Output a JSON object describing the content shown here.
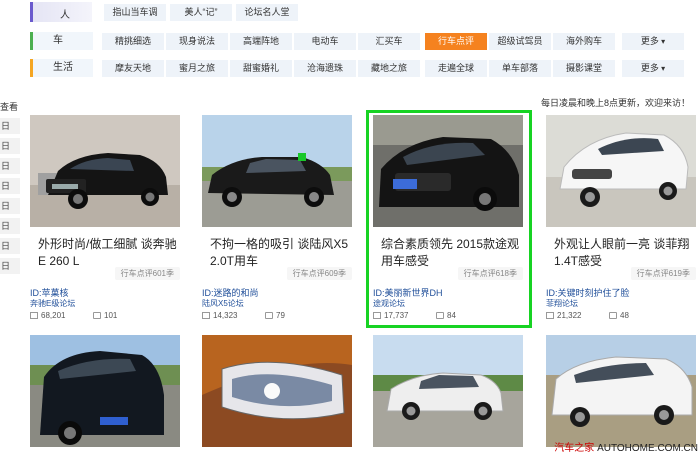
{
  "topbar": {
    "item1": "人",
    "items": [
      "指山当车调",
      "美人“记”",
      "论坛名人堂"
    ]
  },
  "nav_rows": [
    {
      "category": "车",
      "accent": "#4caf50",
      "items": [
        "精挑细选",
        "现身说法",
        "高端阵地",
        "电动车",
        "汇买车",
        "行车点评",
        "超级试驾员",
        "海外购车",
        "更多"
      ]
    },
    {
      "category": "生活",
      "accent": "#f5a623",
      "items": [
        "摩友天地",
        "蜜月之旅",
        "甜蜜婚礼",
        "沧海遗珠",
        "藏地之旅",
        "走遍全球",
        "单车部落",
        "摄影课堂",
        "更多"
      ]
    }
  ],
  "active_nav": "行车点评",
  "left_strip": {
    "label": "查看",
    "cells": [
      "日",
      "日",
      "日",
      "日",
      "日",
      "日",
      "日",
      "日"
    ]
  },
  "notice": "每日凌晨和晚上8点更新，欢迎来访！",
  "cards": [
    {
      "title": "外形时尚/做工细腻 谈奔驰E 260 L",
      "tag": "行车点评601季",
      "author": "ID:苹菓核",
      "forum": "奔驰E级论坛",
      "views": "68,201",
      "replies": "101"
    },
    {
      "title": "不拘一格的吸引 谈陆风X5 2.0T用车",
      "tag": "行车点评609季",
      "author": "ID:迷路的和尚",
      "forum": "陆风X5论坛",
      "views": "14,323",
      "replies": "79"
    },
    {
      "title": "综合素质领先 2015款途观用车感受",
      "tag": "行车点评618季",
      "author": "ID:美丽新世界DH",
      "forum": "途观论坛",
      "views": "17,737",
      "replies": "84"
    },
    {
      "title": "外观让人眼前一亮 谈菲翔1.4T感受",
      "tag": "行车点评619季",
      "author": "ID:关键时刻护住了脸",
      "forum": "菲翔论坛",
      "views": "21,322",
      "replies": "48"
    }
  ],
  "watermark": {
    "brand": "汽车之家",
    "site": "AUTOHOME.COM.CN"
  }
}
